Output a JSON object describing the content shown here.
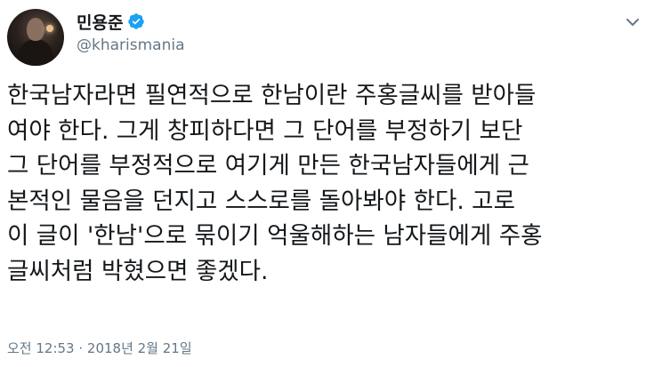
{
  "author": {
    "display_name": "민용준",
    "handle": "@kharismania",
    "verified": true,
    "avatar": "profile-photo"
  },
  "tweet": {
    "text": "한국남자라면 필연적으로 한남이란 주홍글씨를 받아들\n여야 한다. 그게 창피하다면 그 단어를 부정하기 보단\n그 단어를 부정적으로 여기게 만든 한국남자들에게 근\n본적인 물음을 던지고 스스로를 돌아봐야 한다. 고로\n이 글이 '한남'으로 묶이기 억울해하는 남자들에게 주홍\n글씨처럼 박혔으면 좋겠다.",
    "timestamp": "오전 12:53 · 2018년 2월 21일"
  },
  "icons": {
    "verified": "verified-badge-icon",
    "menu": "chevron-down-icon"
  },
  "colors": {
    "accent": "#1da1f2",
    "text": "#14171a",
    "secondary": "#657786"
  }
}
